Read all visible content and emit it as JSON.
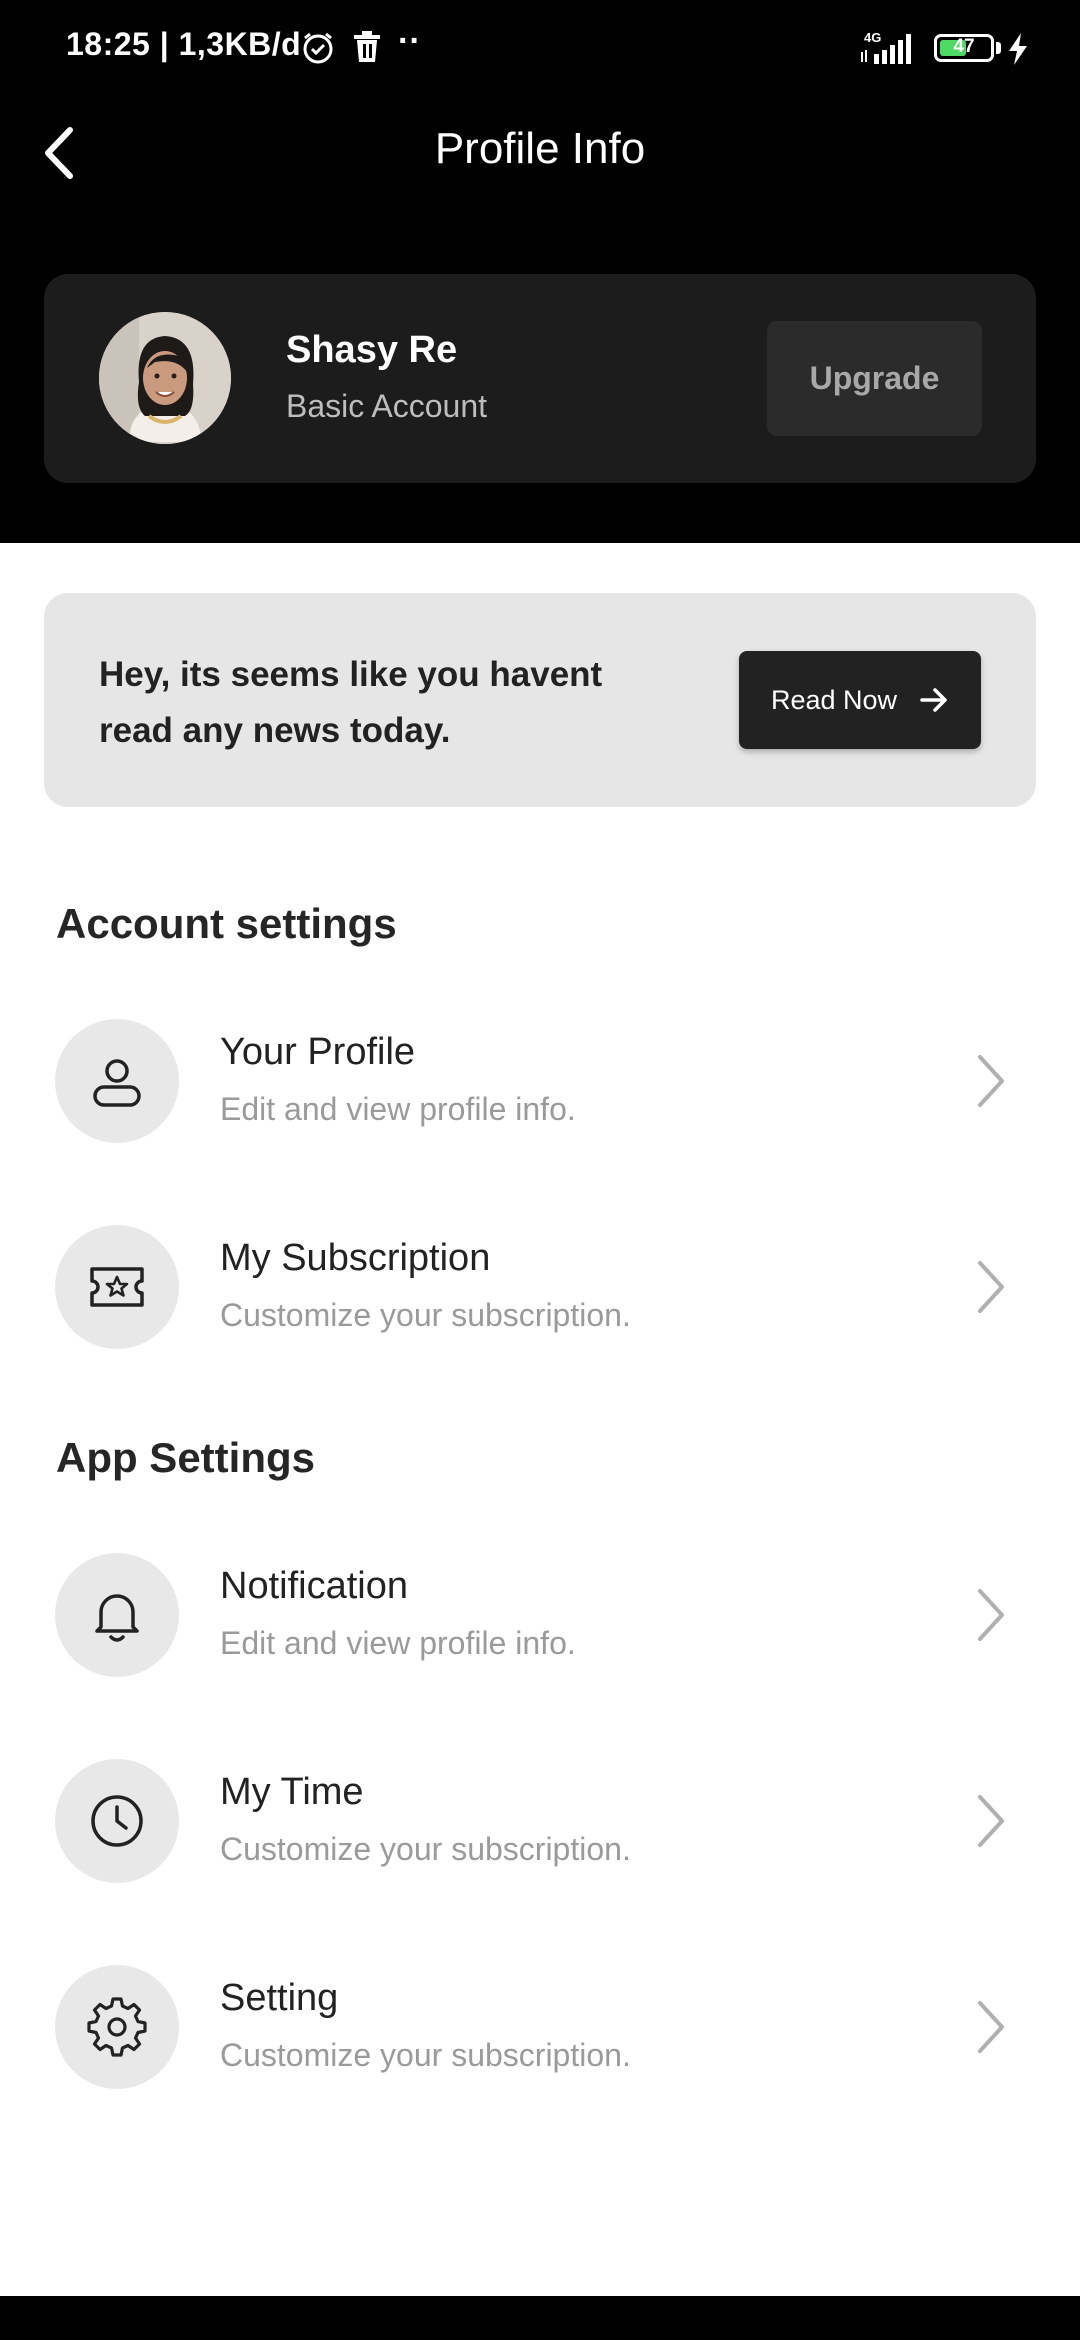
{
  "status_bar": {
    "time": "18:25 | 1,3KB/d",
    "network": "4G",
    "battery": "47",
    "icons": [
      "alarm-icon",
      "trash-icon",
      "more-dots",
      "signal-icon",
      "battery-icon",
      "charging-icon"
    ]
  },
  "header": {
    "title": "Profile Info",
    "back_icon": "chevron-left-icon"
  },
  "profile": {
    "name": "Shasy Re",
    "account_type": "Basic Account",
    "upgrade_label": "Upgrade"
  },
  "news_banner": {
    "message": "Hey, its seems like you havent read any news today.",
    "button_label": "Read Now",
    "button_icon": "arrow-right-icon"
  },
  "account_settings": {
    "heading": "Account settings",
    "items": [
      {
        "title": "Your Profile",
        "subtitle": "Edit and view profile info.",
        "icon": "user-icon"
      },
      {
        "title": "My Subscription",
        "subtitle": "Customize your subscription.",
        "icon": "ticket-star-icon"
      }
    ]
  },
  "app_settings": {
    "heading": "App Settings",
    "items": [
      {
        "title": "Notification",
        "subtitle": "Edit and view profile info.",
        "icon": "bell-icon"
      },
      {
        "title": "My Time",
        "subtitle": "Customize your subscription.",
        "icon": "clock-icon"
      },
      {
        "title": "Setting",
        "subtitle": "Customize your subscription.",
        "icon": "gear-icon"
      }
    ]
  },
  "colors": {
    "header_bg": "#000000",
    "card_dark": "#1c1c1c",
    "banner_bg": "#e6e6e6",
    "icon_circle": "#e8e8e8",
    "button_dark": "#222222"
  }
}
